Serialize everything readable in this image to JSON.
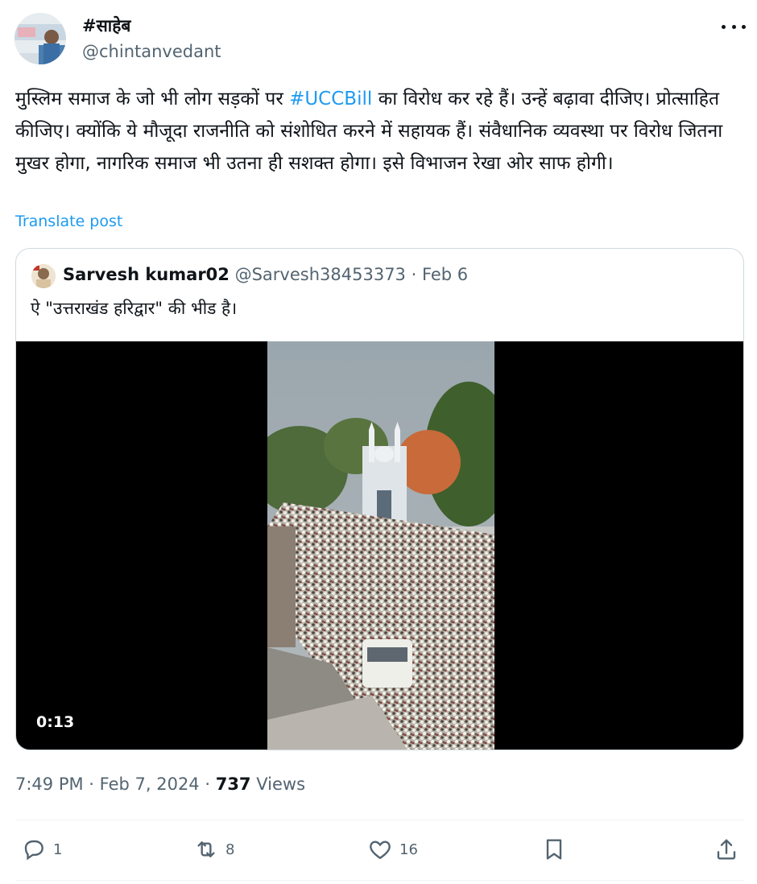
{
  "author": {
    "display_name": "#साहेब",
    "handle": "@chintanvedant"
  },
  "post": {
    "text_before": "मुस्लिम समाज के जो भी लोग सड़कों पर ",
    "hashtag": "#UCCBill",
    "text_after": " का विरोध कर रहे हैं। उन्हें बढ़ावा दीजिए। प्रोत्साहित कीजिए। क्योंकि ये मौजूदा राजनीति को संशोधित करने में सहायक हैं। संवैधानिक व्यवस्था पर विरोध जितना मुखर होगा, नागरिक समाज भी उतना ही सशक्त होगा। इसे विभाजन रेखा ओर साफ होगी।",
    "translate_label": "Translate post"
  },
  "quote": {
    "display_name": "Sarvesh kumar02",
    "handle": "@Sarvesh38453373",
    "separator": " · ",
    "date": "Feb 6",
    "text": "ऐ \"उत्तराखंड हरिद्वार\" की भीड है।",
    "video_duration": "0:13"
  },
  "meta": {
    "time": "7:49 PM",
    "separator": " · ",
    "date": "Feb 7, 2024",
    "views_count": "737",
    "views_label": "Views"
  },
  "actions": {
    "replies": "1",
    "reposts": "8",
    "likes": "16"
  },
  "icons": [
    "more-icon",
    "reply-icon",
    "repost-icon",
    "like-icon",
    "bookmark-icon",
    "share-icon"
  ],
  "colors": {
    "accent": "#1d9bf0",
    "text": "#0f1419",
    "secondary": "#536471",
    "border": "#cfd9de"
  }
}
